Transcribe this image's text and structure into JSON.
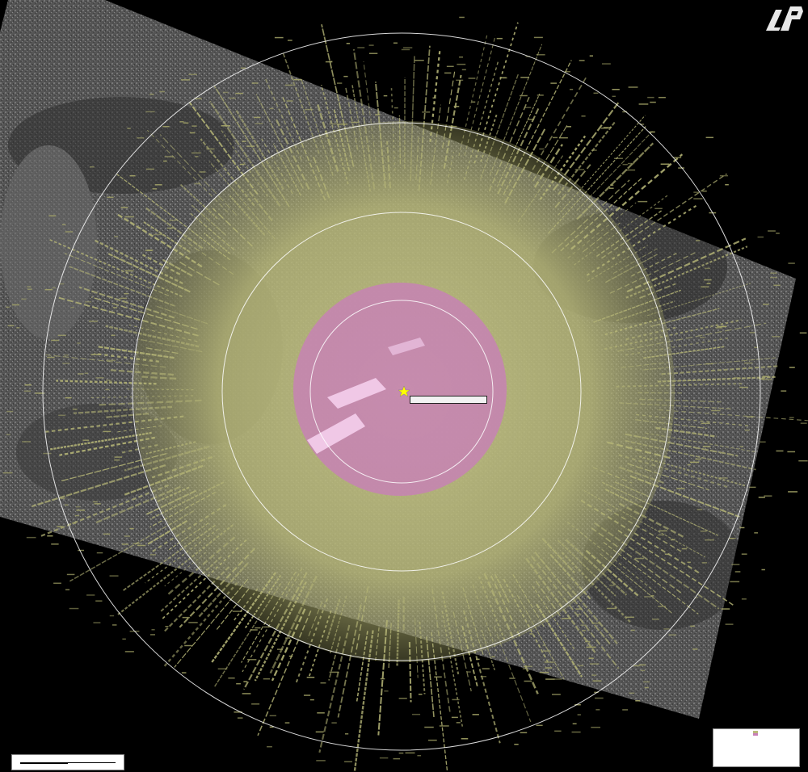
{
  "map": {
    "ring_labels": [
      "",
      "",
      "",
      ""
    ],
    "observer_label": "",
    "colors": {
      "background": "#000000",
      "imagery": "#5a5a5a",
      "visible_area": "#b9b97a",
      "inner_zone": "#c87fb8",
      "rings": "#ffffff",
      "observer": "#ffff00"
    }
  },
  "scalebar": {
    "title": "",
    "tick_left": "",
    "tick_mid": "",
    "tick_right": ""
  },
  "legend": {
    "lines": [
      "",
      "",
      "",
      "",
      "",
      "",
      ""
    ]
  },
  "logo": {
    "icon": "brand-logo-icon"
  }
}
